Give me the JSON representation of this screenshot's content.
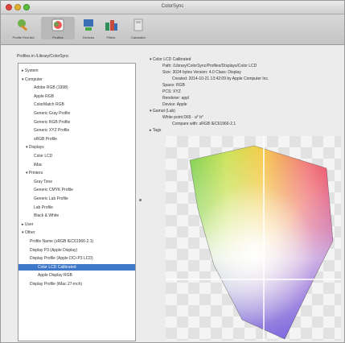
{
  "window": {
    "title": "ColorSync"
  },
  "toolbar": {
    "items": [
      {
        "label": "Profile First Aid",
        "icon": "wrench-icon",
        "selected": false
      },
      {
        "label": "Profiles",
        "icon": "profiles-icon",
        "selected": true
      },
      {
        "label": "Devices",
        "icon": "devices-icon",
        "selected": false
      },
      {
        "label": "Filters",
        "icon": "filters-icon",
        "selected": false
      },
      {
        "label": "Calculator",
        "icon": "calculator-icon",
        "selected": false
      }
    ]
  },
  "left": {
    "header": "Profiles in /Library/ColorSync"
  },
  "tree": {
    "items": [
      {
        "label": "▸ System",
        "indent": 0,
        "selected": false
      },
      {
        "label": "▾ Computer",
        "indent": 0,
        "selected": false
      },
      {
        "label": "Adobe RGB (1998)",
        "indent": 3,
        "selected": false
      },
      {
        "label": "Apple RGB",
        "indent": 3,
        "selected": false
      },
      {
        "label": "ColorMatch RGB",
        "indent": 3,
        "selected": false
      },
      {
        "label": "Generic Gray Profile",
        "indent": 3,
        "selected": false
      },
      {
        "label": "Generic RGB Profile",
        "indent": 3,
        "selected": false
      },
      {
        "label": "Generic XYZ Profile",
        "indent": 3,
        "selected": false
      },
      {
        "label": "sRGB Profile",
        "indent": 3,
        "selected": false
      },
      {
        "label": "▾ Displays",
        "indent": 1,
        "selected": false
      },
      {
        "label": "Color LCD",
        "indent": 3,
        "selected": false
      },
      {
        "label": "iMac",
        "indent": 3,
        "selected": false
      },
      {
        "label": "▾ Printers",
        "indent": 1,
        "selected": false
      },
      {
        "label": "Gray Tone",
        "indent": 3,
        "selected": false
      },
      {
        "label": "Generic CMYK Profile",
        "indent": 3,
        "selected": false
      },
      {
        "label": "Generic Lab Profile",
        "indent": 3,
        "selected": false
      },
      {
        "label": "Lab Profile",
        "indent": 3,
        "selected": false
      },
      {
        "label": "Black & White",
        "indent": 3,
        "selected": false
      },
      {
        "label": "▸ User",
        "indent": 0,
        "selected": false
      },
      {
        "label": "▾ Other",
        "indent": 0,
        "selected": false
      },
      {
        "label": "Profile Name (sRGB IEC61966-2.1)",
        "indent": 2,
        "selected": false
      },
      {
        "label": "Display P3 (Apple Display)",
        "indent": 2,
        "selected": false
      },
      {
        "label": "Display Profile (Apple DCI-P3 LCD)",
        "indent": 2,
        "selected": false
      },
      {
        "label": "Color LCD Calibrated",
        "indent": 4,
        "selected": true
      },
      {
        "label": "Apple Display RGB",
        "indent": 4,
        "selected": false
      },
      {
        "label": "Display Profile (iMac 27-inch)",
        "indent": 2,
        "selected": false
      }
    ]
  },
  "info": {
    "lines": [
      {
        "text": "▾ Color LCD Calibrated",
        "indent": 0
      },
      {
        "text": "Path: /Library/ColorSync/Profiles/Displays/Color LCD",
        "indent": 4
      },
      {
        "text": "Size: 3024 bytes   Version: 4.0   Class: Display",
        "indent": 4
      },
      {
        "text": "Created: 2014-10-21 13:42:09 by Apple Computer Inc.",
        "indent": 7
      },
      {
        "text": "Space: RGB",
        "indent": 4
      },
      {
        "text": "PCS: XYZ",
        "indent": 4
      },
      {
        "text": "Renderer: appl",
        "indent": 4
      },
      {
        "text": "Device: Apple",
        "indent": 4
      },
      {
        "text": "▾ Gamut (Lab)",
        "indent": 0
      },
      {
        "text": "White point D65 · a* b*",
        "indent": 4
      },
      {
        "text": "Compare with: sRGB IEC61966-2.1",
        "indent": 7
      },
      {
        "text": "▸ Tags",
        "indent": 0
      }
    ]
  },
  "gamut": {
    "label": "Lab gamut plot",
    "hull_color": "#333333"
  }
}
